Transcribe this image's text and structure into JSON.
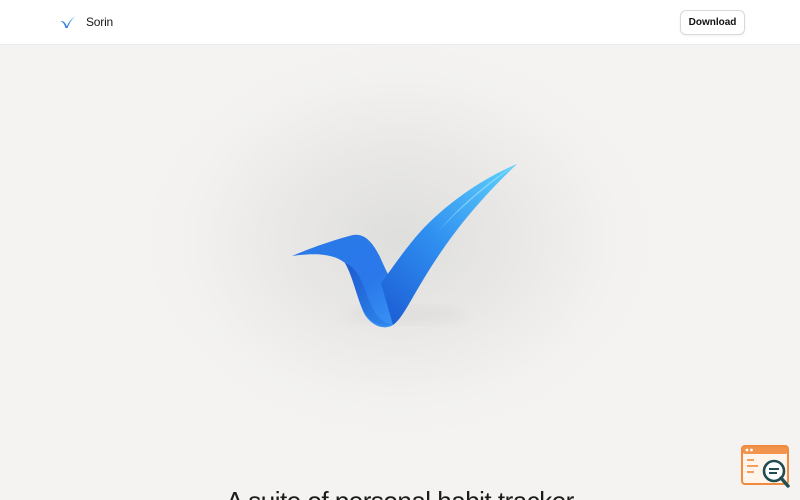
{
  "header": {
    "brand_name": "Sorin",
    "brand_icon": "checkmark-logo-icon",
    "download_label": "Download"
  },
  "hero": {
    "mark_icon": "blue-checkmark-icon",
    "headline": "A suite of personal habit tracker"
  },
  "widget": {
    "icon": "search-inspect-icon"
  },
  "colors": {
    "accent": "#2f8ff0",
    "accent_light": "#55c8f8",
    "accent_dark": "#1f63d8",
    "widget_orange": "#f08a3c",
    "widget_teal": "#1f4d52"
  }
}
